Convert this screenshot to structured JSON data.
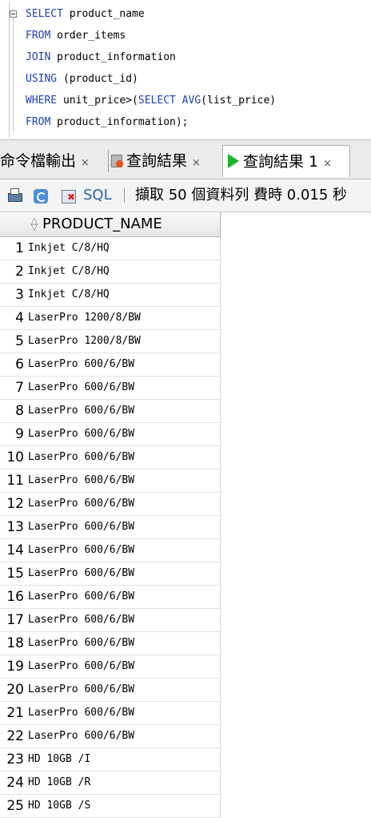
{
  "editor": {
    "lines": [
      {
        "kw": "SELECT",
        "rest": " product_name"
      },
      {
        "kw": "FROM",
        "rest": " order_items"
      },
      {
        "kw": "JOIN",
        "rest": " product_information"
      },
      {
        "kw": "USING",
        "rest": " (product_id)"
      },
      {
        "kw": "WHERE",
        "rest": " unit_price>(",
        "kw2": "SELECT AVG",
        "rest2": "(list_price)"
      },
      {
        "kw": "FROM",
        "rest": " product_information);"
      }
    ]
  },
  "tabs": [
    {
      "label": "命令檔輸出",
      "close": "×"
    },
    {
      "label": "查詢結果",
      "close": "×"
    },
    {
      "label": "查詢結果 1",
      "close": "×"
    }
  ],
  "toolbar": {
    "sql_label": "SQL",
    "status": "擷取 50 個資料列 費時 0.015 秒"
  },
  "grid": {
    "column": "PRODUCT_NAME",
    "rows": [
      {
        "n": "1",
        "v": "Inkjet C/8/HQ"
      },
      {
        "n": "2",
        "v": "Inkjet C/8/HQ"
      },
      {
        "n": "3",
        "v": "Inkjet C/8/HQ"
      },
      {
        "n": "4",
        "v": "LaserPro 1200/8/BW"
      },
      {
        "n": "5",
        "v": "LaserPro 1200/8/BW"
      },
      {
        "n": "6",
        "v": "LaserPro 600/6/BW"
      },
      {
        "n": "7",
        "v": "LaserPro 600/6/BW"
      },
      {
        "n": "8",
        "v": "LaserPro 600/6/BW"
      },
      {
        "n": "9",
        "v": "LaserPro 600/6/BW"
      },
      {
        "n": "10",
        "v": "LaserPro 600/6/BW"
      },
      {
        "n": "11",
        "v": "LaserPro 600/6/BW"
      },
      {
        "n": "12",
        "v": "LaserPro 600/6/BW"
      },
      {
        "n": "13",
        "v": "LaserPro 600/6/BW"
      },
      {
        "n": "14",
        "v": "LaserPro 600/6/BW"
      },
      {
        "n": "15",
        "v": "LaserPro 600/6/BW"
      },
      {
        "n": "16",
        "v": "LaserPro 600/6/BW"
      },
      {
        "n": "17",
        "v": "LaserPro 600/6/BW"
      },
      {
        "n": "18",
        "v": "LaserPro 600/6/BW"
      },
      {
        "n": "19",
        "v": "LaserPro 600/6/BW"
      },
      {
        "n": "20",
        "v": "LaserPro 600/6/BW"
      },
      {
        "n": "21",
        "v": "LaserPro 600/6/BW"
      },
      {
        "n": "22",
        "v": "LaserPro 600/6/BW"
      },
      {
        "n": "23",
        "v": "HD 10GB /I"
      },
      {
        "n": "24",
        "v": "HD 10GB /R"
      },
      {
        "n": "25",
        "v": "HD 10GB /S"
      }
    ]
  }
}
